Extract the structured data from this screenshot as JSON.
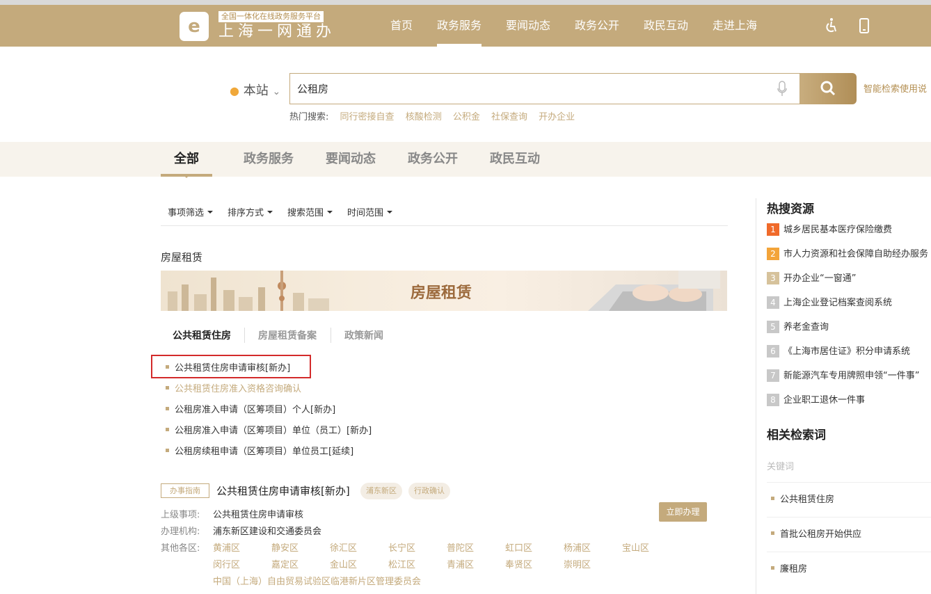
{
  "header": {
    "tagline": "全国一体化在线政务服务平台",
    "site_name": "上海一网通办",
    "nav": [
      "首页",
      "政务服务",
      "要闻动态",
      "政务公开",
      "政民互动",
      "走进上海"
    ],
    "active_nav": "政务服务",
    "accent": "#c4aa7c"
  },
  "search": {
    "scope": "本站",
    "query": "公租房",
    "hot_label": "热门搜索:",
    "hot_keywords": [
      "同行密接自查",
      "核酸检测",
      "公积金",
      "社保查询",
      "开办企业"
    ],
    "smart_help": "智能检索使用说"
  },
  "tabs": [
    "全部",
    "政务服务",
    "要闻动态",
    "政务公开",
    "政民互动"
  ],
  "filters": [
    "事项筛选",
    "排序方式",
    "搜索范围",
    "时间范围"
  ],
  "section": {
    "title": "房屋租赁",
    "banner_title": "房屋租赁",
    "subtabs": [
      "公共租赁住房",
      "房屋租赁备案",
      "政策新闻"
    ],
    "items": [
      "公共租赁住房申请审核[新办]",
      "公共租赁住房准入资格咨询确认",
      "公租房准入申请（区筹项目）个人[新办]",
      "公租房准入申请（区筹项目）单位（员工）[新办]",
      "公租房续租申请（区筹项目）单位员工[延续]"
    ]
  },
  "guide": {
    "badge": "办事指南",
    "title": "公共租赁住房申请审核[新办]",
    "tags": [
      "浦东新区",
      "行政确认"
    ],
    "action": "立即办理",
    "parent_label": "上级事项:",
    "parent_value": "公共租赁住房申请审核",
    "agency_label": "办理机构:",
    "agency_value": "浦东新区建设和交通委员会",
    "districts_label": "其他各区:",
    "districts": [
      "黄浦区",
      "静安区",
      "徐汇区",
      "长宁区",
      "普陀区",
      "虹口区",
      "杨浦区",
      "宝山区",
      "闵行区",
      "嘉定区",
      "金山区",
      "松江区",
      "青浦区",
      "奉贤区",
      "崇明区",
      "中国（上海）自由贸易试验区临港新片区管理委员会"
    ]
  },
  "sidebar": {
    "hot_title": "热搜资源",
    "hot_items": [
      {
        "rank": "1",
        "text": "城乡居民基本医疗保险缴费",
        "color": "#f06a2a"
      },
      {
        "rank": "2",
        "text": "市人力资源和社会保障自助经办服务",
        "color": "#f3a43a"
      },
      {
        "rank": "3",
        "text": "开办企业“一窗通”",
        "color": "#d6c29b"
      },
      {
        "rank": "4",
        "text": "上海企业登记档案查阅系统",
        "color": "#c8c8c8"
      },
      {
        "rank": "5",
        "text": "养老金查询",
        "color": "#c8c8c8"
      },
      {
        "rank": "6",
        "text": "《上海市居住证》积分申请系统",
        "color": "#c8c8c8"
      },
      {
        "rank": "7",
        "text": "新能源汽车专用牌照申领“一件事”",
        "color": "#c8c8c8"
      },
      {
        "rank": "8",
        "text": "企业职工退休一件事",
        "color": "#c8c8c8"
      }
    ],
    "related_title": "相关检索词",
    "keyword_label": "关键词",
    "related_items": [
      "公共租赁住房",
      "首批公租房开始供应",
      "廉租房"
    ]
  }
}
